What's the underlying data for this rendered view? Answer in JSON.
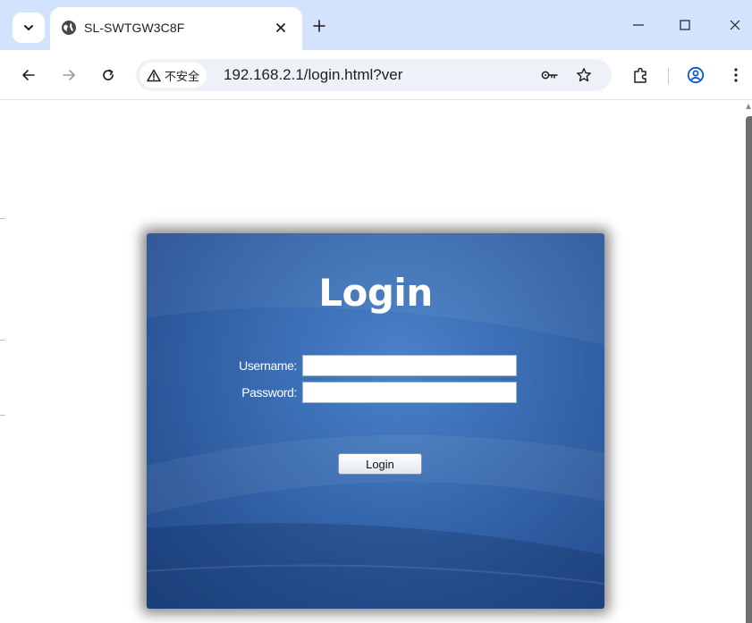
{
  "browser": {
    "tab": {
      "title": "SL-SWTGW3C8F",
      "favicon": "globe-icon"
    },
    "window_controls": [
      "minimize-icon",
      "maximize-icon",
      "close-icon"
    ],
    "address_bar": {
      "security_label": "不安全",
      "url": "192.168.2.1/login.html?ver"
    },
    "toolbar_icons": [
      "back-icon",
      "forward-icon",
      "reload-icon",
      "key-icon",
      "star-icon",
      "extensions-icon",
      "profile-icon",
      "more-icon"
    ]
  },
  "page": {
    "title": "Login",
    "fields": {
      "username_label": "Username:",
      "username_value": "",
      "password_label": "Password:",
      "password_value": ""
    },
    "submit_label": "Login"
  },
  "colors": {
    "tabstrip": "#d3e3fd",
    "panel_blue": "#2b579a",
    "profile_accent": "#0b57d0"
  }
}
